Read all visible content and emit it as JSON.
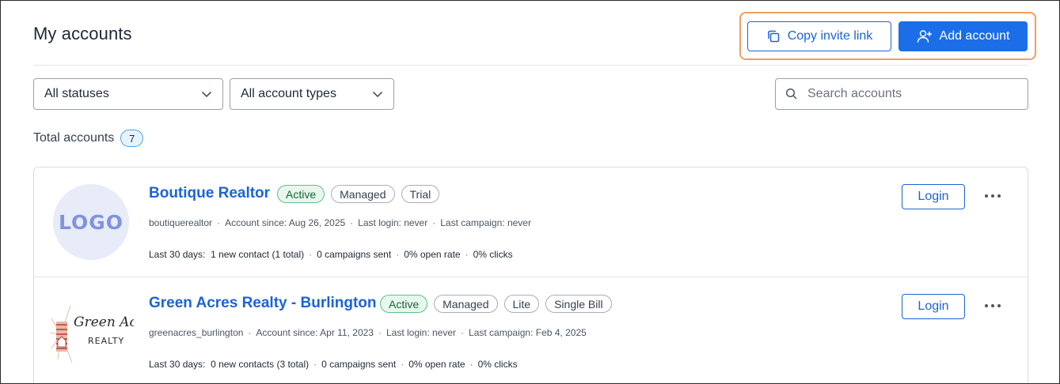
{
  "header": {
    "title": "My accounts",
    "copy_invite_label": "Copy invite link",
    "add_account_label": "Add account"
  },
  "filters": {
    "status": {
      "selected": "All statuses"
    },
    "types": {
      "selected": "All account types"
    },
    "search": {
      "placeholder": "Search accounts"
    }
  },
  "summary": {
    "total_label": "Total accounts",
    "total_count": "7"
  },
  "accounts": [
    {
      "name": "Boutique Realtor",
      "logo_text": "LOGO",
      "tags": [
        "Active",
        "Managed",
        "Trial"
      ],
      "username": "boutiquerealtor",
      "account_since": "Account since: Aug 26, 2025",
      "last_login": "Last login: never",
      "last_campaign": "Last campaign: never",
      "stats_label": "Last 30 days:",
      "contacts": "1 new contact (1 total)",
      "campaigns": "0 campaigns sent",
      "open_rate": "0% open rate",
      "clicks": "0% clicks",
      "login_label": "Login"
    },
    {
      "name": "Green Acres Realty - Burlington",
      "logo_text_1": "Green Acres",
      "logo_text_2": "REALTY",
      "tags": [
        "Active",
        "Managed",
        "Lite",
        "Single Bill"
      ],
      "username": "greenacres_burlington",
      "account_since": "Account since: Apr 11, 2023",
      "last_login": "Last login: never",
      "last_campaign": "Last campaign: Feb 4, 2025",
      "stats_label": "Last 30 days:",
      "contacts": "0 new contacts (3 total)",
      "campaigns": "0 campaigns sent",
      "open_rate": "0% open rate",
      "clicks": "0% clicks",
      "login_label": "Login"
    }
  ],
  "colors": {
    "primary": "#1b6ee8",
    "link": "#1b64d6",
    "highlight": "#f0a060",
    "active_bg": "#e8f7ee",
    "active_border": "#5cc28a"
  }
}
